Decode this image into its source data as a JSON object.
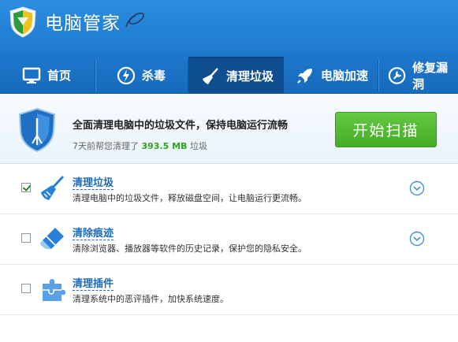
{
  "app": {
    "title": "电脑管家"
  },
  "nav": {
    "tabs": [
      {
        "label": "首页",
        "icon": "monitor-icon",
        "active": false
      },
      {
        "label": "杀毒",
        "icon": "virus-scan-icon",
        "active": false
      },
      {
        "label": "清理垃圾",
        "icon": "broom-icon",
        "active": true
      },
      {
        "label": "电脑加速",
        "icon": "rocket-icon",
        "active": false
      },
      {
        "label": "修复漏洞",
        "icon": "repair-icon",
        "active": false
      }
    ]
  },
  "header": {
    "headline": "全面清理电脑中的垃圾文件，保持电脑运行流畅",
    "sub_prefix": "7天前帮您清理了",
    "sub_amount": "393.5 MB",
    "sub_suffix": "垃圾",
    "scan_button": "开始扫描"
  },
  "items": [
    {
      "title": "清理垃圾",
      "desc": "清理电脑中的垃圾文件，释放磁盘空间，让电脑运行更流畅。",
      "checked": true,
      "icon": "broom-icon",
      "expandable": true
    },
    {
      "title": "清除痕迹",
      "desc": "清除浏览器、播放器等软件的历史记录，保护您的隐私安全。",
      "checked": false,
      "icon": "eraser-icon",
      "expandable": true
    },
    {
      "title": "清理插件",
      "desc": "清理系统中的恶评插件，加快系统速度。",
      "checked": false,
      "icon": "puzzle-icon",
      "expandable": false
    }
  ],
  "colors": {
    "accent": "#1f7bd0",
    "scan_button": "#52b832",
    "amount": "#2ea51d",
    "link": "#1c6bb8"
  }
}
